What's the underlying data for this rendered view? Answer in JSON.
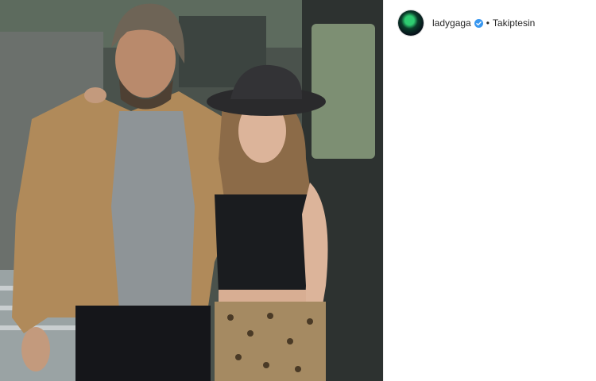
{
  "post": {
    "author": {
      "username": "ladygaga",
      "verified": true,
      "avatar_icon": "profile-avatar"
    },
    "separator": "•",
    "follow_status": "Takiptesin",
    "image": {
      "description_icon": "photo-couple-outdoors"
    }
  },
  "colors": {
    "text": "#262626",
    "verified_badge": "#3897f0",
    "border": "#efefef"
  }
}
